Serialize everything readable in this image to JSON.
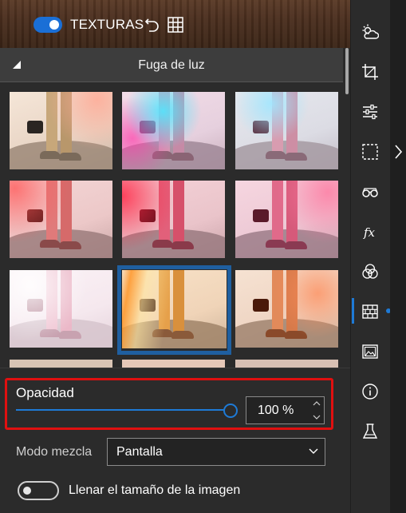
{
  "header": {
    "textures_toggle_on": true,
    "textures_label": "TEXTURAS",
    "undo_icon": "undo-icon",
    "grid_icon": "grid-icon"
  },
  "section": {
    "title": "Fuga de luz",
    "collapse_icon": "collapse-triangle-icon"
  },
  "thumbnails": {
    "count_visible": 9,
    "selected_index": 4
  },
  "opacity": {
    "label": "Opacidad",
    "value_percent": 100,
    "value_text": "100 %"
  },
  "blend": {
    "label": "Modo mezcla",
    "selected": "Pantalla"
  },
  "fill": {
    "label": "Llenar el tamaño de la imagen",
    "toggle_on": false
  },
  "toolbar": {
    "items": [
      "weather-icon",
      "crop-icon",
      "sliders-icon",
      "selection-icon",
      "glasses-icon",
      "fx-icon",
      "color-circles-icon",
      "texture-brick-icon",
      "image-frame-icon",
      "info-icon",
      "flask-icon"
    ],
    "active": "texture-brick-icon",
    "accent": "#1e7ad6"
  },
  "colors": {
    "highlight_box": "#e01010",
    "accent": "#1e7ad6"
  }
}
